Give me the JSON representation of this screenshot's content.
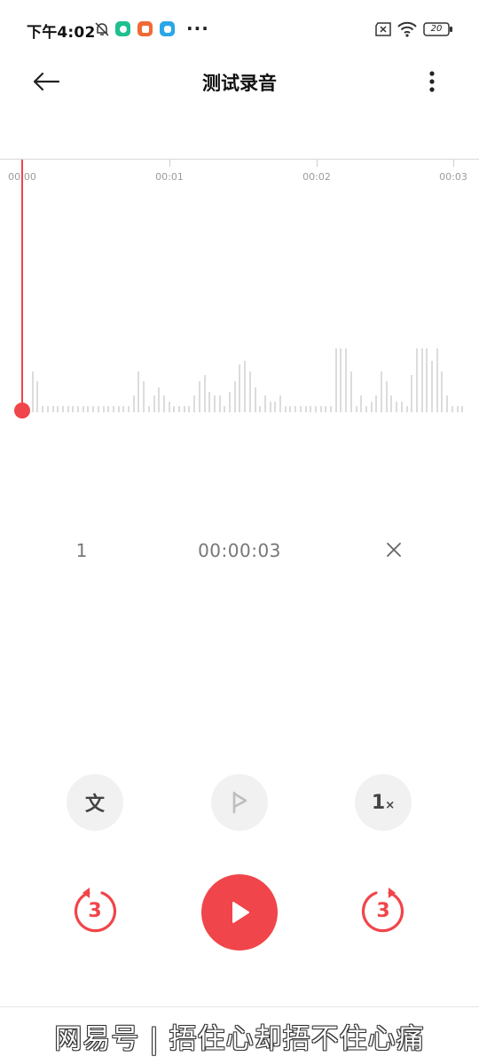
{
  "status_bar": {
    "time": "下午4:02",
    "icons": [
      "bell-off-icon",
      "app-green-icon",
      "app-orange-icon",
      "app-blue-icon",
      "overflow-dots-icon",
      "sim-missing-icon",
      "wifi-icon",
      "battery-icon"
    ],
    "dots": "···",
    "battery_level": "20",
    "colors": {
      "green_app": "#1fbf8f",
      "orange_app": "#f06a35",
      "blue_app": "#2ba6e8"
    }
  },
  "header": {
    "title": "测试录音",
    "back_icon": "arrow-left-icon",
    "more_icon": "vertical-dots-icon"
  },
  "timeline": {
    "labels": [
      "00:00",
      "00:01",
      "00:02",
      "00:03"
    ],
    "playhead_color": "#f0454a"
  },
  "waveform": {
    "levels": [
      0.05,
      0.32,
      0.24,
      0.05,
      0.05,
      0.05,
      0.05,
      0.05,
      0.05,
      0.05,
      0.05,
      0.05,
      0.05,
      0.05,
      0.05,
      0.05,
      0.05,
      0.05,
      0.05,
      0.05,
      0.05,
      0.13,
      0.32,
      0.24,
      0.05,
      0.13,
      0.19,
      0.13,
      0.08,
      0.05,
      0.05,
      0.05,
      0.05,
      0.13,
      0.24,
      0.29,
      0.16,
      0.13,
      0.13,
      0.05,
      0.16,
      0.24,
      0.37,
      0.4,
      0.32,
      0.19,
      0.05,
      0.13,
      0.08,
      0.08,
      0.13,
      0.05,
      0.05,
      0.05,
      0.05,
      0.05,
      0.05,
      0.05,
      0.05,
      0.05,
      0.05,
      0.5,
      0.5,
      0.5,
      0.32,
      0.05,
      0.13,
      0.05,
      0.08,
      0.13,
      0.32,
      0.24,
      0.13,
      0.08,
      0.08,
      0.05,
      0.29,
      0.5,
      0.5,
      0.5,
      0.4,
      0.5,
      0.32,
      0.13,
      0.05,
      0.05,
      0.05
    ],
    "color": "#dcdcdc"
  },
  "recording_info": {
    "index": "1",
    "duration": "00:00:03"
  },
  "controls": {
    "transcribe_label": "文",
    "speed_label": "1",
    "speed_suffix": "×",
    "skip_back_seconds": "3",
    "skip_forward_seconds": "3",
    "accent": "#f0454a"
  },
  "watermark": {
    "text": "网易号 | 捂住心却捂不住心痛"
  }
}
